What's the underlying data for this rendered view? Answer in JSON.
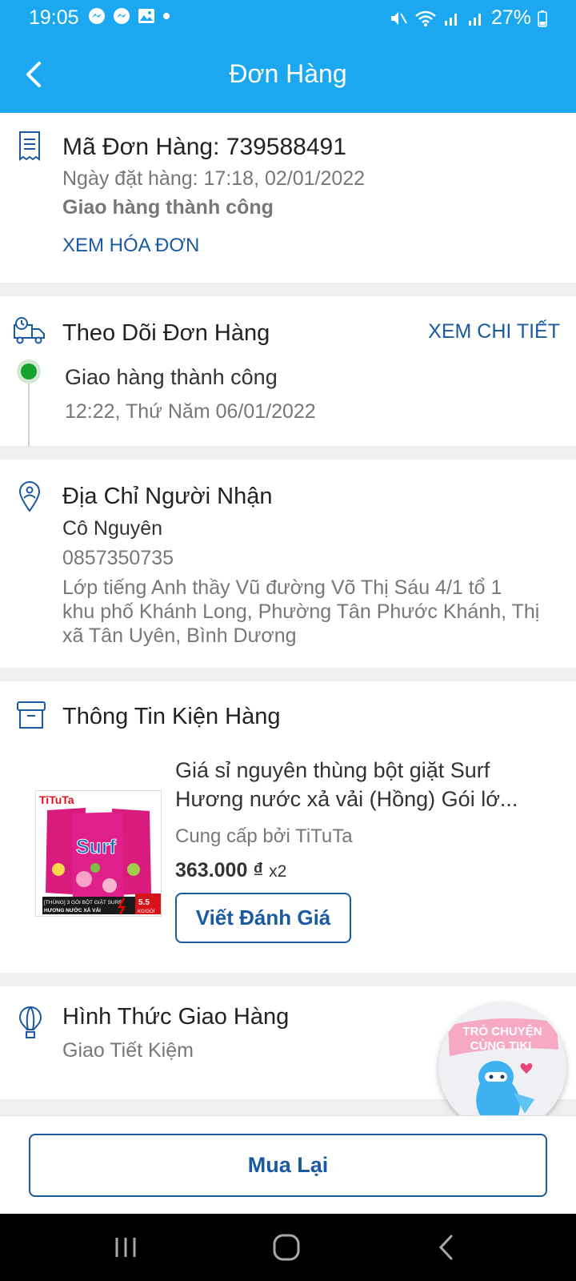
{
  "status_bar": {
    "time": "19:05",
    "battery": "27%"
  },
  "header": {
    "title": "Đơn Hàng"
  },
  "order": {
    "code": "Mã Đơn Hàng: 739588491",
    "date": "Ngày đặt hàng: 17:18, 02/01/2022",
    "status": "Giao hàng thành công",
    "invoice_link": "XEM HÓA ĐƠN"
  },
  "tracking": {
    "title": "Theo Dõi Đơn Hàng",
    "detail_link": "XEM CHI TIẾT",
    "event_status": "Giao hàng thành công",
    "event_time": "12:22, Thứ Năm 06/01/2022"
  },
  "recipient": {
    "title": "Địa Chỉ Người Nhận",
    "name": "Cô Nguyên",
    "phone": "0857350735",
    "address_line1": "Lớp tiếng Anh thầy Vũ đường Võ Thị Sáu 4/1 tổ 1",
    "address_line2": "khu phố Khánh Long, Phường Tân Phước Khánh, Thị",
    "address_line3": "xã Tân Uyên, Bình Dương"
  },
  "package": {
    "title": "Thông Tin Kiện Hàng",
    "product_line1": "Giá sỉ nguyên thùng bột giặt Surf",
    "product_line2": "Hương nước xả vải (Hồng) Gói lớ...",
    "seller": "Cung cấp bởi TiTuTa",
    "price": "363.000 ₫",
    "qty": "x2",
    "review_button": "Viết Đánh Giá",
    "image_brand": "TiTuTa",
    "image_product": "Surf",
    "image_caption": "[THÙNG] 3 GÓI BỘT GIẶT SURF",
    "image_caption2": "HƯƠNG NƯỚC XẢ VẢI",
    "image_weight": "5.5",
    "image_unit": "KG/GÓI"
  },
  "shipping": {
    "title": "Hình Thức Giao Hàng",
    "method": "Giao Tiết Kiệm"
  },
  "chat": {
    "line1": "TRÒ CHUYỆN",
    "line2": "CÙNG TIKI"
  },
  "actions": {
    "buy_again": "Mua Lại"
  },
  "colors": {
    "primary": "#1ba8f0",
    "link": "#1a5aa0",
    "success": "#16a12c"
  }
}
